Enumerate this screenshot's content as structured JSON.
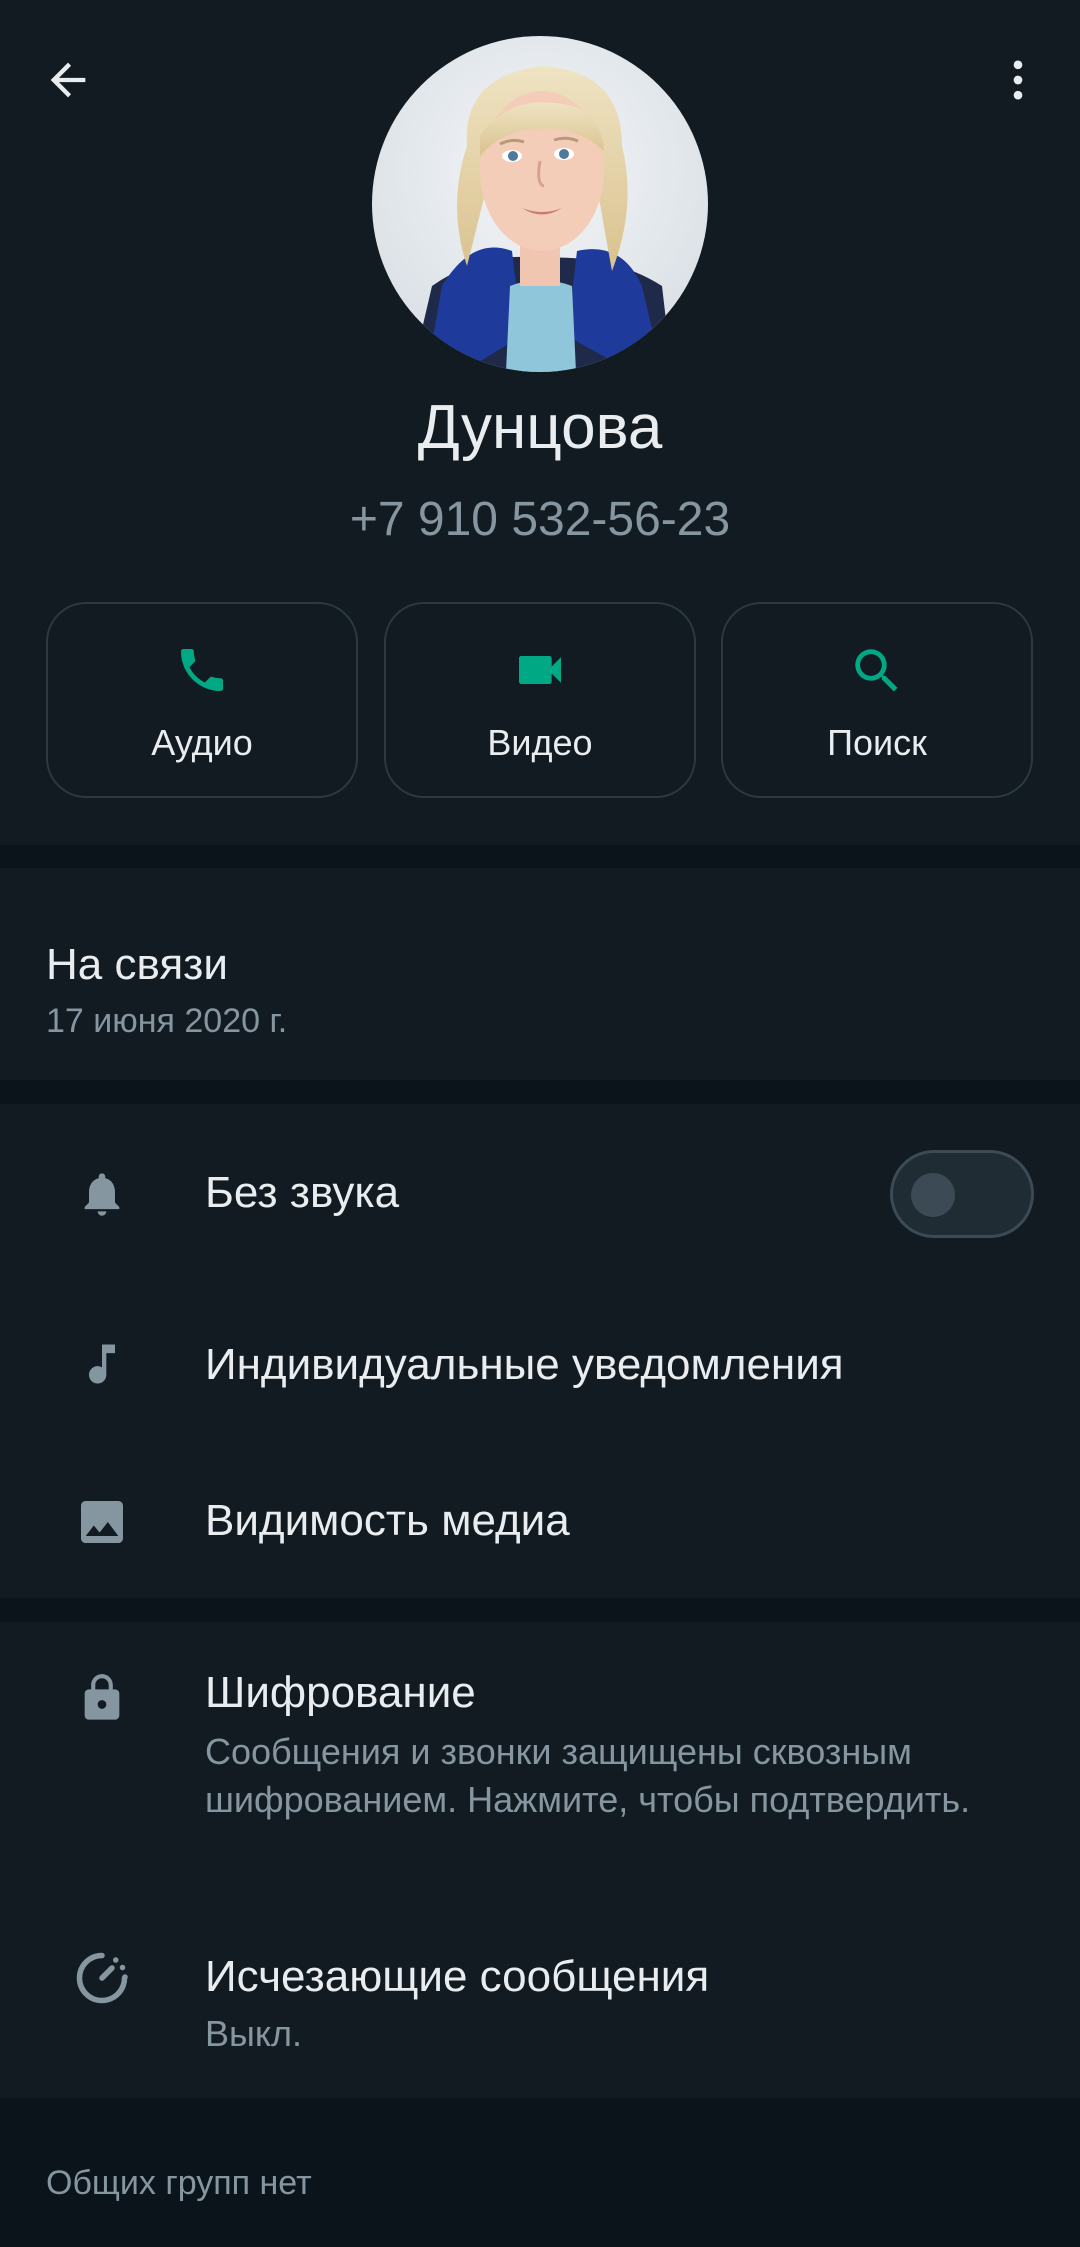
{
  "contact": {
    "name": "Дунцова",
    "phone": "+7 910 532-56-23"
  },
  "actions": [
    {
      "label": "Аудио",
      "icon": "phone-icon"
    },
    {
      "label": "Видео",
      "icon": "videocam-icon"
    },
    {
      "label": "Поиск",
      "icon": "search-icon"
    }
  ],
  "status": {
    "title": "На связи",
    "date": "17 июня 2020 г."
  },
  "settings": {
    "mute_label": "Без звука",
    "mute_enabled": false,
    "custom_notifications_label": "Индивидуальные уведомления",
    "media_visibility_label": "Видимость медиа"
  },
  "security": {
    "encryption_title": "Шифрование",
    "encryption_sub": "Сообщения и звонки защищены сквозным шифрованием. Нажмите, чтобы подтвердить.",
    "disappearing_title": "Исчезающие сообщения",
    "disappearing_sub": "Выкл."
  },
  "groups_note": "Общих групп нет",
  "colors": {
    "background": "#0b141a",
    "panel": "#121b22",
    "accent": "#00a884",
    "text_primary": "#e9edef",
    "text_secondary": "#8696a0"
  }
}
